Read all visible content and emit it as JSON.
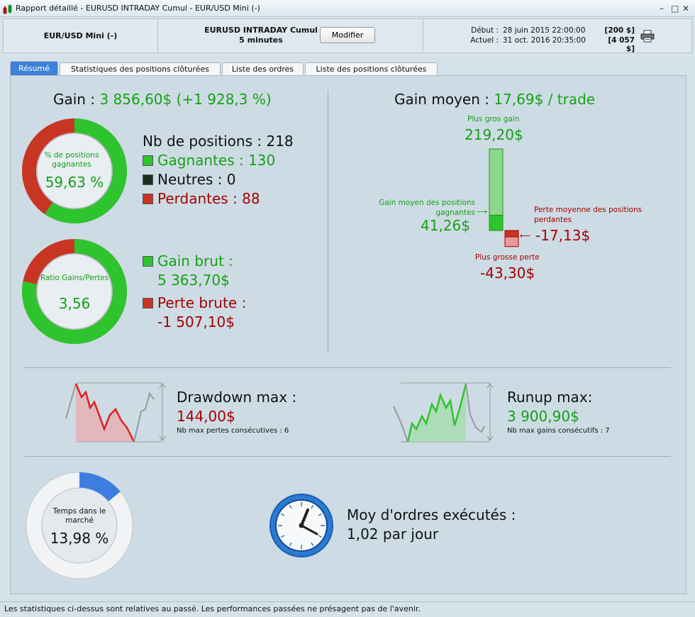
{
  "window": {
    "title": "Rapport détaillé - EURUSD INTRADAY Cumul - EUR/USD Mini (-)"
  },
  "header": {
    "instrument": "EUR/USD Mini (-)",
    "strategy_name": "EURUSD INTRADAY Cumul",
    "strategy_period": "5 minutes",
    "modify_label": "Modifier",
    "start_label": "Début :",
    "start_date": "28 juin 2015 22:00:00",
    "start_amount": "[200 $]",
    "current_label": "Actuel :",
    "current_date": "31 oct. 2016 20:35:00",
    "current_amount": "[4 057 $]"
  },
  "tabs": [
    "Résumé",
    "Statistiques des positions clôturées",
    "Liste des ordres",
    "Liste des positions clôturées"
  ],
  "summary": {
    "gain_label": "Gain :",
    "gain_value": "3 856,60$ (+1 928,3 %)",
    "win_donut_label": "% de positions gagnantes",
    "win_pct": "59,63 %",
    "win_fraction": 0.5963,
    "positions_label": "Nb de positions : 218",
    "winners": "Gagnantes : 130",
    "neutral": "Neutres : 0",
    "losers": "Perdantes : 88",
    "ratio_label": "Ratio Gains/Pertes",
    "ratio_value": "3,56",
    "ratio_fraction": 0.781,
    "gross_gain_label": "Gain brut :",
    "gross_gain_value": "5 363,70$",
    "gross_loss_label": "Perte brute :",
    "gross_loss_value": "-1 507,10$",
    "avg_gain_label": "Gain moyen :",
    "avg_gain_value": "17,69$ / trade",
    "biggest_gain_label": "Plus gros gain",
    "biggest_gain_value": "219,20$",
    "avg_win_label": "Gain moyen des positions gagnantes",
    "avg_win_value": "41,26$",
    "avg_loss_label": "Perte moyenne des positions perdantes",
    "avg_loss_value": "-17,13$",
    "biggest_loss_label": "Plus grosse perte",
    "biggest_loss_value": "-43,30$",
    "bar_chart": {
      "max_gain": 219.2,
      "avg_win": 41.26,
      "avg_loss": -17.13,
      "max_loss": -43.3
    },
    "drawdown_label": "Drawdown max :",
    "drawdown_value": "144,00$",
    "drawdown_sub": "Nb max pertes consécutives : 6",
    "runup_label": "Runup max:",
    "runup_value": "3 900,90$",
    "runup_sub": "Nb max gains consécutifs : 7",
    "market_time_label": "Temps dans le marché",
    "market_time_value": "13,98 %",
    "market_time_fraction": 0.1398,
    "orders_label": "Moy d'ordres exécutés :",
    "orders_value": "1,02 par jour"
  },
  "colors": {
    "green": "#16a016",
    "red": "#a50000",
    "blue": "#3d82d8"
  },
  "footer": "Les statistiques ci-dessus sont relatives au passé. Les performances passées ne présagent pas de l'avenir."
}
